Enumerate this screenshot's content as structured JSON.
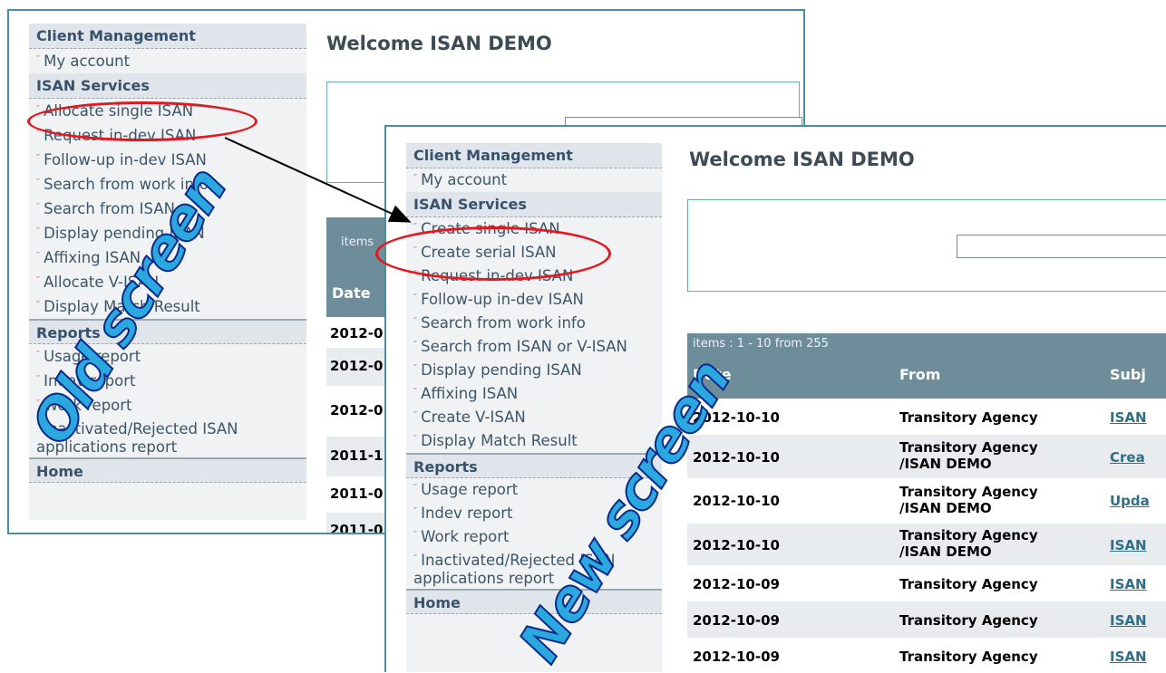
{
  "old_screen": {
    "welcome": "Welcome ISAN DEMO",
    "items_text": "items",
    "date_header": "Date",
    "sidebar": {
      "client_management": "Client Management",
      "my_account": "My account",
      "isan_services": "ISAN Services",
      "services": [
        "Allocate single ISAN",
        "Request in-dev ISAN",
        "Follow-up in-dev ISAN",
        "Search from work info",
        "Search from ISAN",
        "Display pending ISAN",
        "Affixing ISAN",
        "Allocate V-ISAN",
        "Display Match Result"
      ],
      "reports": "Reports",
      "report_items": [
        "Usage report",
        "Indev report",
        "Work report",
        "Inactivated/Rejected ISAN applications report"
      ],
      "home": "Home"
    },
    "dates": [
      "2012-0",
      "2012-0",
      "2012-0",
      "2011-1",
      "2011-0",
      "2011-0"
    ]
  },
  "new_screen": {
    "welcome": "Welcome ISAN DEMO",
    "items_range": "items : 1 - 10 from 255",
    "columns": [
      "Date",
      "From",
      "Subj"
    ],
    "sidebar": {
      "client_management": "Client Management",
      "my_account": "My account",
      "isan_services": "ISAN Services",
      "services": [
        "Create single ISAN",
        "Create serial ISAN",
        "Request in-dev ISAN",
        "Follow-up in-dev ISAN",
        "Search from work info",
        "Search from ISAN or V-ISAN",
        "Display pending ISAN",
        "Affixing ISAN",
        "Create V-ISAN",
        "Display Match Result"
      ],
      "reports": "Reports",
      "report_items": [
        "Usage report",
        "Indev report",
        "Work report",
        "Inactivated/Rejected ISAN applications report"
      ],
      "home": "Home"
    },
    "rows": [
      {
        "date": "2012-10-10",
        "from": "Transitory Agency",
        "subj": "ISAN"
      },
      {
        "date": "2012-10-10",
        "from": "Transitory Agency /ISAN DEMO",
        "subj": "Crea"
      },
      {
        "date": "2012-10-10",
        "from": "Transitory Agency /ISAN DEMO",
        "subj": "Upda"
      },
      {
        "date": "2012-10-10",
        "from": "Transitory Agency /ISAN DEMO",
        "subj": "ISAN"
      },
      {
        "date": "2012-10-09",
        "from": "Transitory Agency",
        "subj": "ISAN"
      },
      {
        "date": "2012-10-09",
        "from": "Transitory Agency",
        "subj": "ISAN"
      },
      {
        "date": "2012-10-09",
        "from": "Transitory Agency",
        "subj": "ISAN"
      }
    ]
  },
  "labels": {
    "old": "Old screen",
    "new": "New screen"
  },
  "colors": {
    "frame": "#4a8fa0",
    "highlight": "#e5161e",
    "label_fill": "#2ca8e0"
  }
}
